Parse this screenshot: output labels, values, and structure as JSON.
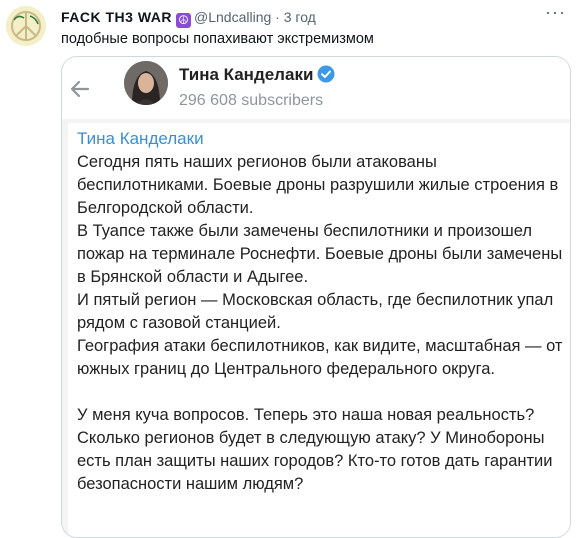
{
  "tweet": {
    "author_name": "FACK TH3 WAR",
    "handle": "@Lndcalling",
    "separator": "·",
    "time": "3 год",
    "text": "подобные вопросы попахивают экстремизмом",
    "more_label": "···"
  },
  "quote": {
    "channel_name": "Тина Канделаки",
    "subscribers": "296 608 subscribers",
    "message_sender": "Тина Канделаки",
    "paragraphs": [
      "Сегодня пять наших регионов были атакованы беспилотниками. Боевые дроны разрушили жилые строения в Белгородской области.",
      "В Туапсе также были замечены беспилотники и произошел пожар на терминале Роснефти. Боевые дроны были замечены в Брянской области и Адыгее.",
      "И пятый регион — Московская область, где беспилотник упал рядом с газовой станцией.",
      "География атаки беспилотников, как видите, масштабная — от южных границ до Центрального федерального округа."
    ],
    "paragraph2": "У меня куча вопросов. Теперь это наша новая реальность? Сколько регионов будет в следующую атаку? У Минобороны есть план защиты наших городов? Кто-то готов дать гарантии безопасности нашим людям?"
  },
  "colors": {
    "link_blue": "#3a8fd1",
    "verified_blue": "#3d99e8",
    "peace_purple": "#8a4bd6",
    "muted_gray": "#536471"
  },
  "icons": {
    "avatar": "peace-symbol-avatar",
    "emoji": "peace-icon",
    "back": "back-arrow-icon",
    "verified": "verified-badge-icon"
  }
}
